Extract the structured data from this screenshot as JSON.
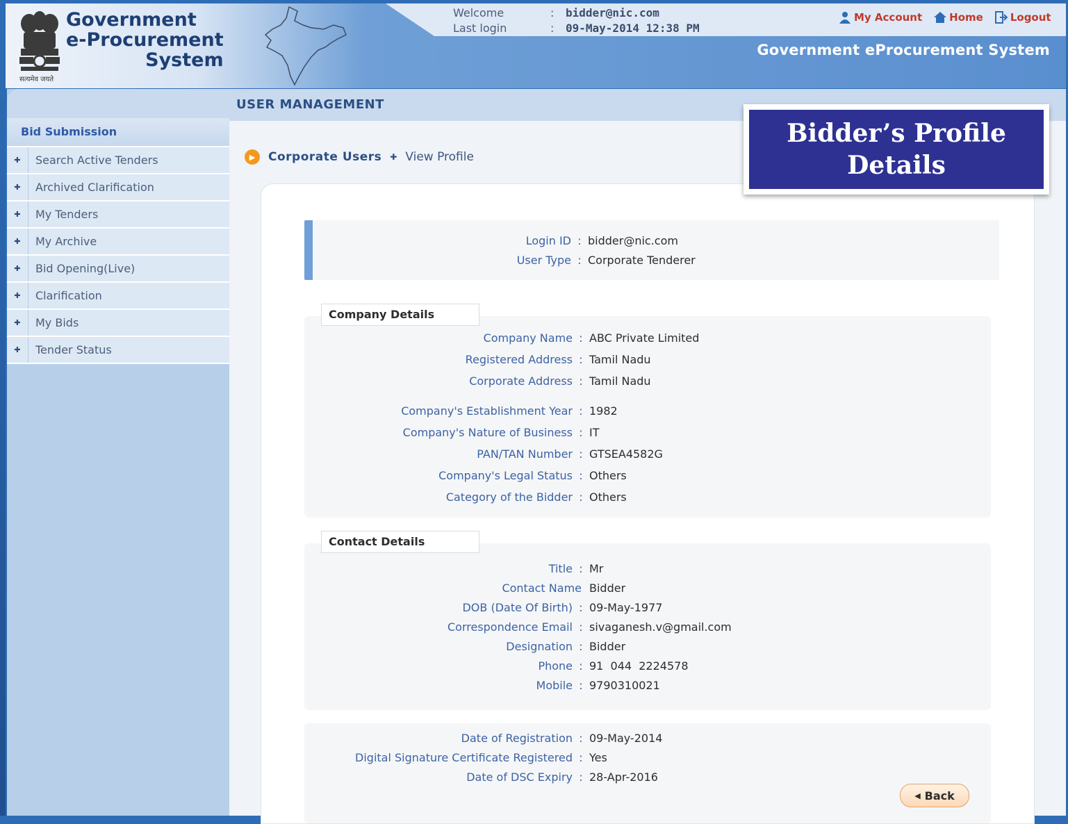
{
  "header": {
    "brand_line1": "Government",
    "brand_line2": "e-Procurement",
    "brand_line3": "System",
    "emblem_caption": "सत्यमेव जयते",
    "welcome_label": "Welcome",
    "welcome_value": "bidder@nic.com",
    "last_login_label": "Last login",
    "last_login_value": "09-May-2014 12:38 PM",
    "separator": ":",
    "links": {
      "my_account": "My Account",
      "home": "Home",
      "logout": "Logout"
    },
    "system_name": "Government eProcurement System"
  },
  "sidebar": {
    "section": "Bid Submission",
    "items": [
      {
        "label": "Search Active Tenders"
      },
      {
        "label": "Archived Clarification"
      },
      {
        "label": "My Tenders"
      },
      {
        "label": "My Archive"
      },
      {
        "label": "Bid Opening(Live)"
      },
      {
        "label": "Clarification"
      },
      {
        "label": "My Bids"
      },
      {
        "label": "Tender Status"
      }
    ]
  },
  "main": {
    "title": "USER MANAGEMENT",
    "breadcrumb": {
      "parent": "Corporate Users",
      "current": "View Profile"
    },
    "login": {
      "login_id_label": "Login ID",
      "login_id": "bidder@nic.com",
      "user_type_label": "User Type",
      "user_type": "Corporate Tenderer"
    },
    "company": {
      "legend": "Company Details",
      "rows": [
        {
          "label": "Company Name",
          "value": "ABC Private Limited"
        },
        {
          "label": "Registered Address",
          "value": "Tamil Nadu"
        },
        {
          "label": "Corporate Address",
          "value": "Tamil Nadu"
        },
        {
          "label": "Company's Establishment Year",
          "value": "1982"
        },
        {
          "label": "Company's Nature of Business",
          "value": "IT"
        },
        {
          "label": "PAN/TAN Number",
          "value": "GTSEA4582G"
        },
        {
          "label": "Company's Legal Status",
          "value": "Others"
        },
        {
          "label": "Category of the Bidder",
          "value": "Others"
        }
      ]
    },
    "contact": {
      "legend": "Contact Details",
      "rows": [
        {
          "label": "Title",
          "value": "Mr"
        },
        {
          "label": "Contact Name",
          "value": "Bidder"
        },
        {
          "label": "DOB (Date Of Birth)",
          "value": "09-May-1977"
        },
        {
          "label": "Correspondence Email",
          "value": "sivaganesh.v@gmail.com"
        },
        {
          "label": "Designation",
          "value": "Bidder"
        },
        {
          "label": "Phone",
          "value": "91  044  2224578"
        },
        {
          "label": "Mobile",
          "value": "9790310021"
        }
      ]
    },
    "registration": {
      "rows": [
        {
          "label": "Date of Registration",
          "value": "09-May-2014"
        },
        {
          "label": "Digital Signature Certificate Registered",
          "value": "Yes"
        },
        {
          "label": "Date of DSC Expiry",
          "value": "28-Apr-2016"
        }
      ]
    },
    "back_label": "Back",
    "colon": ":"
  },
  "callout": {
    "line1": "Bidder’s Profile",
    "line2": "Details"
  },
  "colors": {
    "accent": "#2e3192",
    "link": "#3c63a4",
    "header": "#5a8fcf",
    "sidebar": "#b7cfe9",
    "logout": "#c0392b"
  }
}
